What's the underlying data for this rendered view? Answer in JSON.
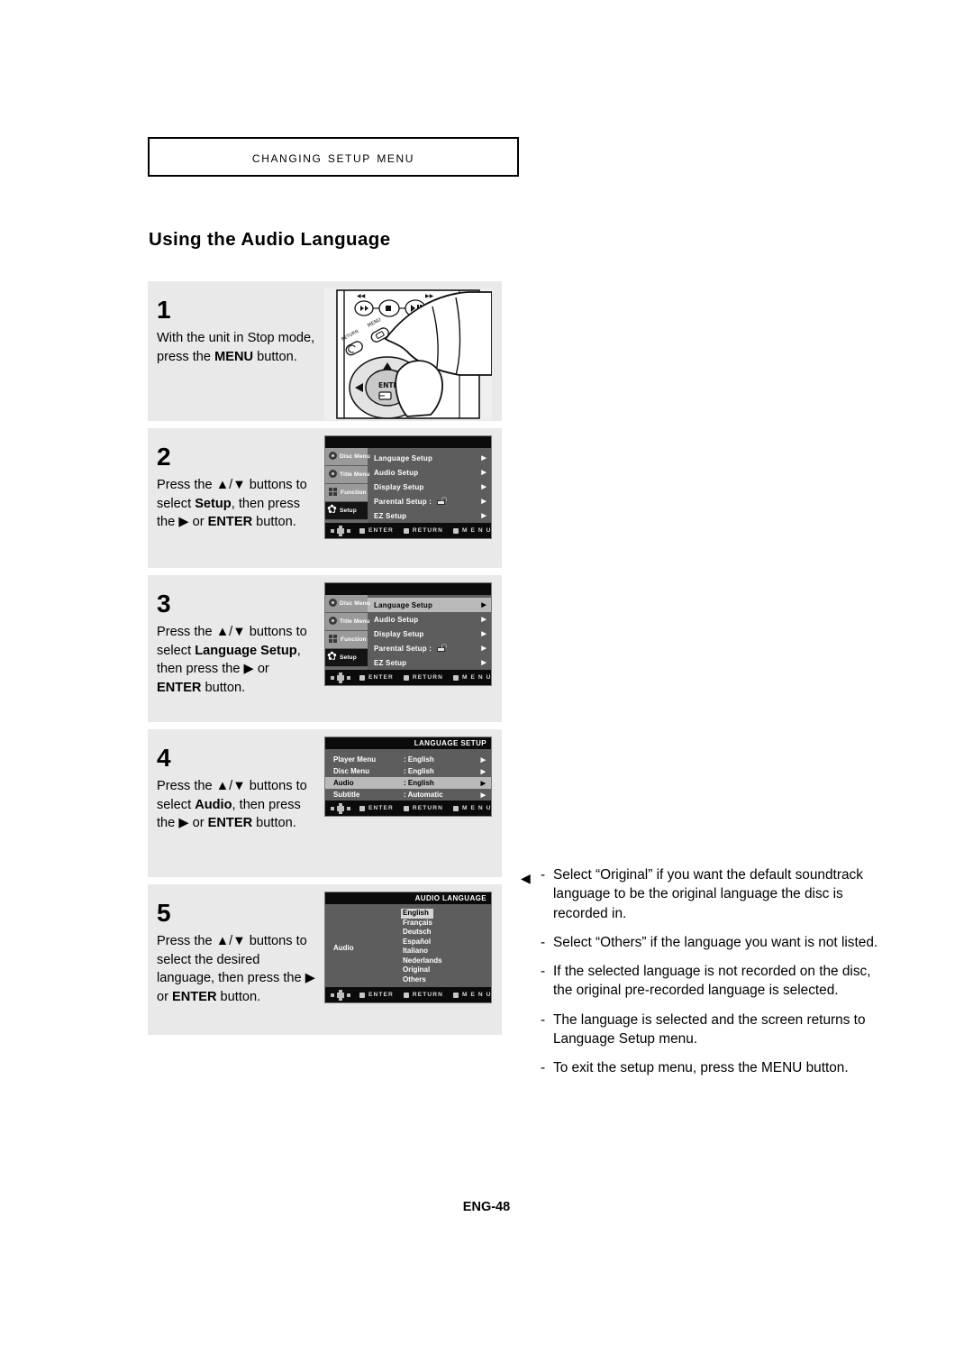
{
  "header": {
    "chapter_title": "Changing Setup menu",
    "section_title": "Using the Audio Language"
  },
  "steps": [
    {
      "number": "1",
      "text_parts": [
        {
          "t": "With the unit in Stop mode, press the ",
          "b": false
        },
        {
          "t": "MENU",
          "b": true
        },
        {
          "t": " button.",
          "b": false
        }
      ],
      "figure": "remote-illustration"
    },
    {
      "number": "2",
      "text_parts": [
        {
          "t": "Press the ▲/▼ buttons to select ",
          "b": false
        },
        {
          "t": "Setup",
          "b": true
        },
        {
          "t": ", then press the ▶ or ",
          "b": false
        },
        {
          "t": "ENTER",
          "b": true
        },
        {
          "t": " button.",
          "b": false
        }
      ],
      "figure": "osd-setup-menu"
    },
    {
      "number": "3",
      "text_parts": [
        {
          "t": "Press the ▲/▼ buttons to select ",
          "b": false
        },
        {
          "t": "Language Setup",
          "b": true
        },
        {
          "t": ", then press the ▶ or ",
          "b": false
        },
        {
          "t": "ENTER",
          "b": true
        },
        {
          "t": " button.",
          "b": false
        }
      ],
      "figure": "osd-setup-menu-language-selected"
    },
    {
      "number": "4",
      "text_parts": [
        {
          "t": "Press the ▲/▼ buttons to select ",
          "b": false
        },
        {
          "t": "Audio",
          "b": true
        },
        {
          "t": ", then press the ▶ or ",
          "b": false
        },
        {
          "t": "ENTER",
          "b": true
        },
        {
          "t": " button.",
          "b": false
        }
      ],
      "figure": "osd-language-setup"
    },
    {
      "number": "5",
      "text_parts": [
        {
          "t": "Press the ▲/▼ buttons to select the desired language, then press the ▶ or ",
          "b": false
        },
        {
          "t": "ENTER",
          "b": true
        },
        {
          "t": " button.",
          "b": false
        }
      ],
      "figure": "osd-audio-language"
    }
  ],
  "osd": {
    "sidebar": [
      {
        "label": "Disc Menu",
        "icon": "disc-menu-icon",
        "selected": false
      },
      {
        "label": "Title Menu",
        "icon": "title-menu-icon",
        "selected": false
      },
      {
        "label": "Function",
        "icon": "function-icon",
        "selected": false
      },
      {
        "label": "Setup",
        "icon": "gear-icon",
        "selected": true
      }
    ],
    "setup_menu_rows": [
      {
        "label": "Language Setup",
        "arrow": "▶",
        "lock": false
      },
      {
        "label": "Audio Setup",
        "arrow": "▶",
        "lock": false
      },
      {
        "label": "Display Setup",
        "arrow": "▶",
        "lock": false
      },
      {
        "label": "Parental Setup :",
        "arrow": "▶",
        "lock": true
      },
      {
        "label": "EZ Setup",
        "arrow": "▶",
        "lock": false
      }
    ],
    "setup_menu_selected_index_step3": 0,
    "language_setup": {
      "title": "LANGUAGE SETUP",
      "rows": [
        {
          "label": "Player Menu",
          "value": ": English",
          "arrow": "▶"
        },
        {
          "label": "Disc Menu",
          "value": ": English",
          "arrow": "▶"
        },
        {
          "label": "Audio",
          "value": ": English",
          "arrow": "▶"
        },
        {
          "label": "Subtitle",
          "value": ": Automatic",
          "arrow": "▶"
        }
      ],
      "selected_index": 2
    },
    "audio_language": {
      "title": "AUDIO LANGUAGE",
      "left_label": "Audio",
      "options": [
        "English",
        "Français",
        "Deutsch",
        "Español",
        "Italiano",
        "Nederlands",
        "Original",
        "Others"
      ],
      "selected_index": 0
    },
    "footer_buttons": [
      "ENTER",
      "RETURN",
      "M E N U"
    ]
  },
  "notes": {
    "marker": "◀",
    "dash": "-",
    "items": [
      "Select “Original” if you want the default soundtrack language to be the original language the disc is recorded in.",
      "Select “Others” if the language you want is not  listed.",
      "If the selected language is not recorded on the disc, the original pre-recorded language is selected.",
      "The language is selected and the screen returns to Language Setup menu.",
      "To exit the setup menu, press the MENU button."
    ]
  },
  "page_footer": "ENG-48"
}
